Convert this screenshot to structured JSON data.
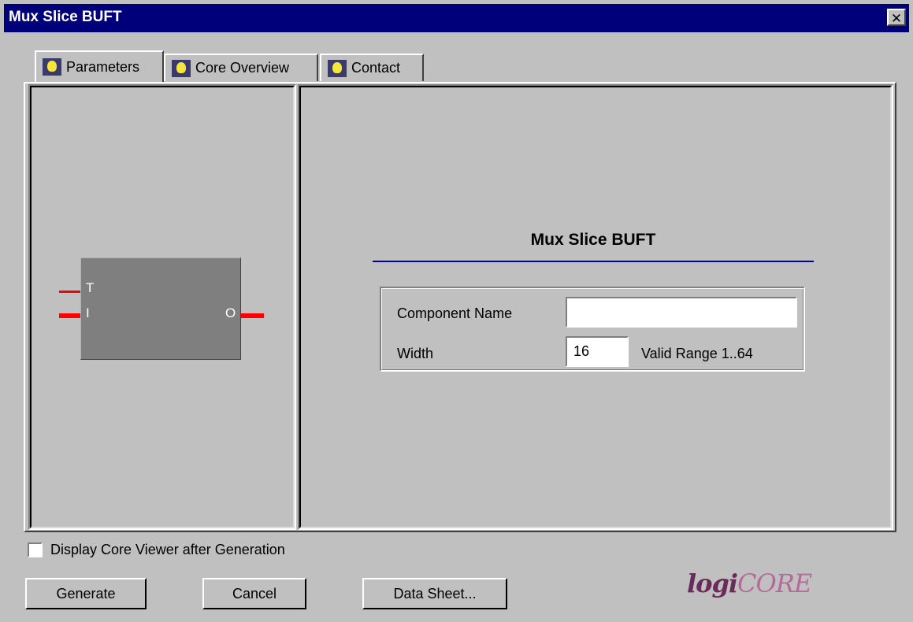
{
  "window": {
    "title": "Mux Slice BUFT",
    "close_glyph": "✕"
  },
  "tabs": [
    {
      "label": "Parameters",
      "icon": "lightbulb-icon",
      "active": true
    },
    {
      "label": "Core Overview",
      "icon": "lightbulb-icon",
      "active": false
    },
    {
      "label": "Contact",
      "icon": "lightbulb-icon",
      "active": false
    }
  ],
  "symbol": {
    "pin_t": "T",
    "pin_i": "I",
    "pin_o": "O"
  },
  "form": {
    "heading": "Mux Slice BUFT",
    "component_name_label": "Component Name",
    "component_name_value": "",
    "width_label": "Width",
    "width_value": "16",
    "width_range": "Valid Range 1..64"
  },
  "options": {
    "display_viewer_label": "Display Core Viewer after Generation",
    "display_viewer_checked": false
  },
  "buttons": {
    "generate": "Generate",
    "cancel": "Cancel",
    "data_sheet": "Data Sheet..."
  },
  "logo": {
    "part1": "logi",
    "part2": "CORE"
  },
  "colors": {
    "titlebar": "#00007b",
    "heading_rule": "#00009c",
    "pin": "#ff0000",
    "symbol_fill": "#7f7f7f"
  }
}
